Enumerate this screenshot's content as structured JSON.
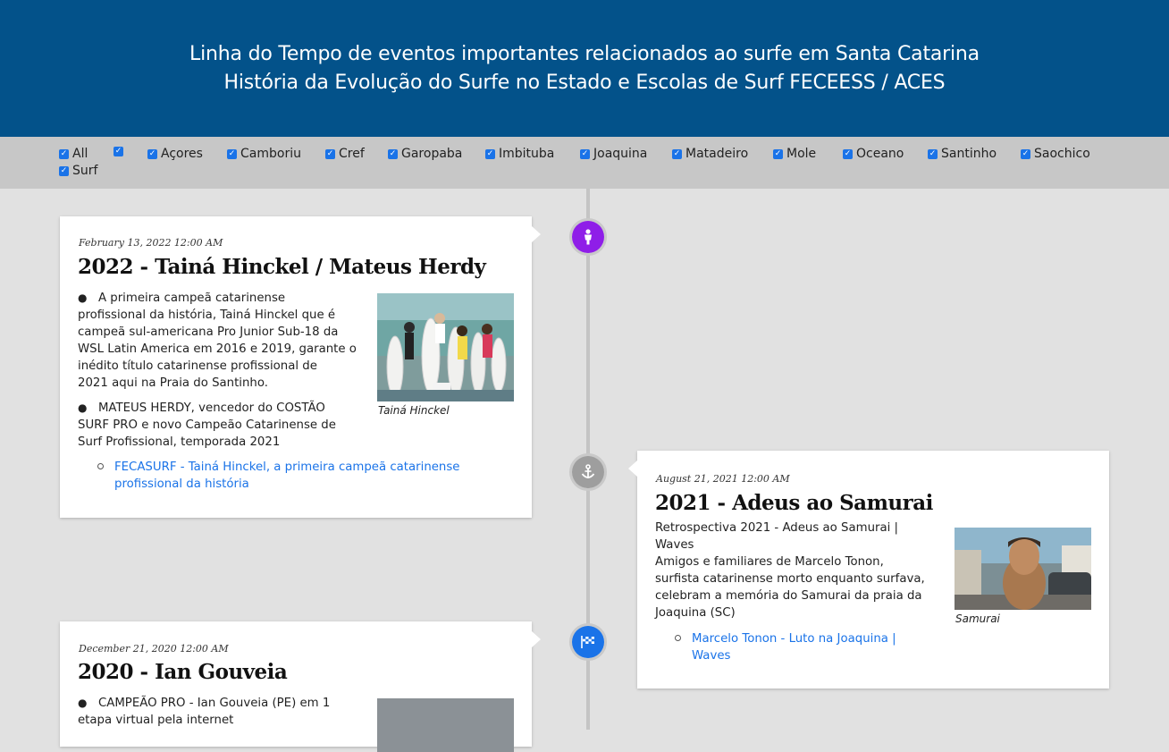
{
  "header": {
    "line1": "Linha do Tempo de eventos importantes relacionados ao surfe em Santa Catarina",
    "line2": "História da Evolução do Surfe no Estado e Escolas de Surf FECEESS / ACES"
  },
  "filters": [
    "All",
    "",
    "Açores",
    "Camboriu",
    "Cref",
    "Garopaba",
    "Imbituba",
    "Joaquina",
    "Matadeiro",
    "Mole",
    "Oceano",
    "Santinho",
    "Saochico",
    "Surf"
  ],
  "events": [
    {
      "date": "February 13, 2022 12:00 AM",
      "title": "2022 - Tainá Hinckel / Mateus Herdy",
      "bullet1_lines": [
        "A primeira campeã catarinense",
        "profissional da história, Tainá Hinckel que é",
        "campeã sul-americana Pro Junior Sub-18 da",
        "WSL Latin America em 2016 e 2019, garante o",
        "inédito título catarinense profissional de",
        "2021 aqui na Praia do Santinho."
      ],
      "bullet2_lines": [
        "MATEUS HERDY, vencedor do COSTÃO",
        "SURF PRO e novo Campeão Catarinense de",
        "Surf Profissional, temporada 2021"
      ],
      "link_lines": [
        "FECASURF - Tainá Hinckel, a primeira campeã catarinense",
        "profissional da história"
      ],
      "caption": "Tainá Hinckel",
      "icon": "person-icon",
      "icon_color": "#8f1ee8"
    },
    {
      "date": "August 21, 2021 12:00 AM",
      "title": "2021 - Adeus ao Samurai",
      "text_lines": [
        "Retrospectiva 2021 - Adeus ao Samurai |",
        "Waves",
        "Amigos e familiares de Marcelo Tonon,",
        "surfista catarinense morto enquanto surfava,",
        "celebram a memória do Samurai da praia da",
        "Joaquina (SC)"
      ],
      "link_lines": [
        "Marcelo Tonon - Luto na Joaquina |",
        "Waves"
      ],
      "caption": "Samurai",
      "icon": "anchor-icon",
      "icon_color": "#9e9e9e"
    },
    {
      "date": "December 21, 2020 12:00 AM",
      "title": "2020 - Ian Gouveia",
      "bullet1_lines": [
        "CAMPEÃO PRO - Ian Gouveia (PE) em 1",
        "etapa virtual pela internet"
      ],
      "icon": "checkered-flag-icon",
      "icon_color": "#1a73e8"
    }
  ]
}
